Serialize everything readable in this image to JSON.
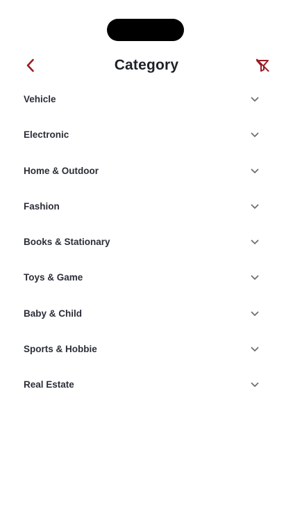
{
  "header": {
    "title": "Category",
    "back_icon": "chevron-left-icon",
    "clear_filter_icon": "filter-off-icon"
  },
  "categories": [
    {
      "label": "Vehicle"
    },
    {
      "label": "Electronic"
    },
    {
      "label": "Home & Outdoor"
    },
    {
      "label": "Fashion"
    },
    {
      "label": "Books & Stationary"
    },
    {
      "label": "Toys & Game"
    },
    {
      "label": "Baby & Child"
    },
    {
      "label": "Sports & Hobbie"
    },
    {
      "label": "Real Estate"
    }
  ],
  "colors": {
    "accent": "#9b1c24",
    "text": "#2b2e38",
    "chevron": "#6b6f78",
    "background": "#ffffff"
  }
}
